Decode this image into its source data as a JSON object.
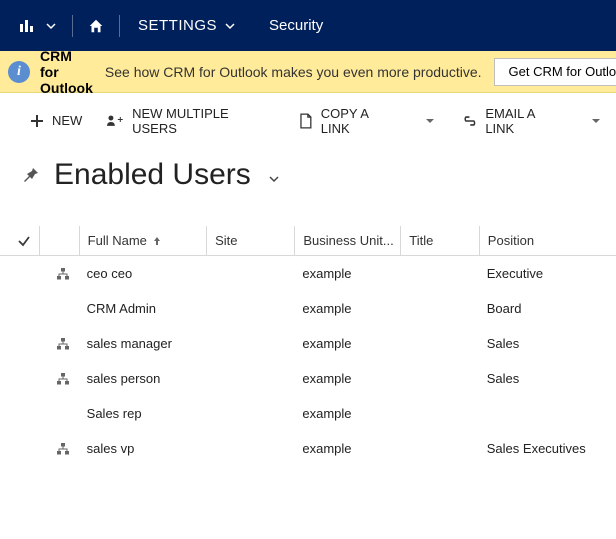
{
  "nav": {
    "settings_label": "SETTINGS",
    "security_label": "Security"
  },
  "notice": {
    "title": "CRM for Outlook",
    "text": "See how CRM for Outlook makes you even more productive.",
    "button": "Get CRM for Outlook"
  },
  "commands": {
    "new": "NEW",
    "new_multiple": "NEW MULTIPLE USERS",
    "copy_link": "COPY A LINK",
    "email_link": "EMAIL A LINK"
  },
  "view": {
    "title": "Enabled Users"
  },
  "grid": {
    "headers": {
      "full_name": "Full Name",
      "site": "Site",
      "business_unit": "Business Unit...",
      "title": "Title",
      "position": "Position"
    },
    "rows": [
      {
        "has_hierarchy": true,
        "full_name": "ceo ceo",
        "site": "",
        "business_unit": "example",
        "title": "",
        "position": "Executive"
      },
      {
        "has_hierarchy": false,
        "full_name": "CRM Admin",
        "site": "",
        "business_unit": "example",
        "title": "",
        "position": "Board"
      },
      {
        "has_hierarchy": true,
        "full_name": "sales manager",
        "site": "",
        "business_unit": "example",
        "title": "",
        "position": "Sales"
      },
      {
        "has_hierarchy": true,
        "full_name": "sales person",
        "site": "",
        "business_unit": "example",
        "title": "",
        "position": "Sales"
      },
      {
        "has_hierarchy": false,
        "full_name": "Sales rep",
        "site": "",
        "business_unit": "example",
        "title": "",
        "position": ""
      },
      {
        "has_hierarchy": true,
        "full_name": "sales vp",
        "site": "",
        "business_unit": "example",
        "title": "",
        "position": "Sales Executives"
      }
    ]
  }
}
